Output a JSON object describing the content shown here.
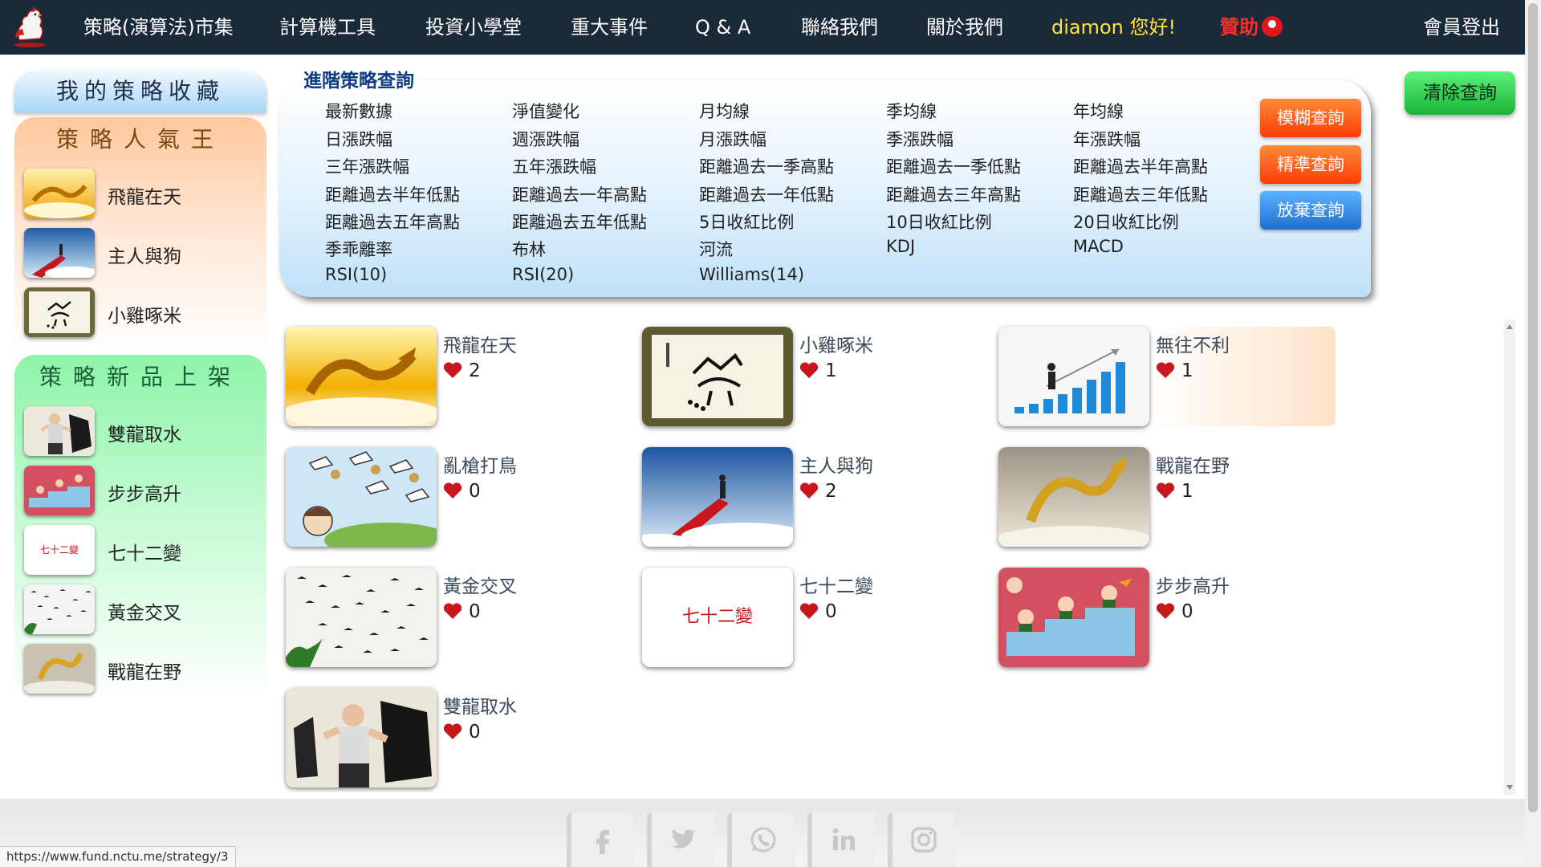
{
  "navbar": {
    "items": [
      "策略(演算法)市集",
      "計算機工具",
      "投資小學堂",
      "重大事件",
      "Q & A",
      "聯絡我們",
      "關於我們"
    ],
    "greeting": "diamon 您好!",
    "sponsor": "贊助",
    "logout": "會員登出"
  },
  "sidebar": {
    "favorites_title": "我的策略收藏",
    "popular_title": "策略人氣王",
    "popular": [
      {
        "name": "飛龍在天",
        "icon": "golden-dragon"
      },
      {
        "name": "主人與狗",
        "icon": "man-on-red-stairs"
      },
      {
        "name": "小雞啄米",
        "icon": "chick-calligraphy"
      }
    ],
    "new_title": "策略新品上架",
    "new": [
      {
        "name": "雙龍取水",
        "icon": "kungfu-master"
      },
      {
        "name": "步步高升",
        "icon": "kids-on-steps"
      },
      {
        "name": "七十二變",
        "icon": "text-tile",
        "thumb_text": "七十二變"
      },
      {
        "name": "黃金交叉",
        "icon": "birds-flock"
      },
      {
        "name": "戰龍在野",
        "icon": "golden-dragon-clouds"
      }
    ]
  },
  "query": {
    "title": "進階策略查詢",
    "items": [
      "最新數據",
      "淨值變化",
      "月均線",
      "季均線",
      "年均線",
      "日漲跌幅",
      "週漲跌幅",
      "月漲跌幅",
      "季漲跌幅",
      "年漲跌幅",
      "三年漲跌幅",
      "五年漲跌幅",
      "距離過去一季高點",
      "距離過去一季低點",
      "距離過去半年高點",
      "距離過去半年低點",
      "距離過去一年高點",
      "距離過去一年低點",
      "距離過去三年高點",
      "距離過去三年低點",
      "距離過去五年高點",
      "距離過去五年低點",
      "5日收紅比例",
      "10日收紅比例",
      "20日收紅比例",
      "季乖離率",
      "布林",
      "河流",
      "KDJ",
      "MACD",
      "RSI(10)",
      "RSI(20)",
      "Williams(14)"
    ],
    "buttons": {
      "fuzzy": "模糊查詢",
      "exact": "精準查詢",
      "cancel": "放棄查詢"
    },
    "clear": "清除查詢"
  },
  "strategies": [
    {
      "name": "飛龍在天",
      "likes": "2",
      "icon": "golden-dragon"
    },
    {
      "name": "小雞啄米",
      "likes": "1",
      "icon": "chick-calligraphy"
    },
    {
      "name": "無往不利",
      "likes": "1",
      "icon": "businessman-bar-chart"
    },
    {
      "name": "亂槍打鳥",
      "likes": "0",
      "icon": "cartoon-storks"
    },
    {
      "name": "主人與狗",
      "likes": "2",
      "icon": "man-on-red-stairs"
    },
    {
      "name": "戰龍在野",
      "likes": "1",
      "icon": "golden-dragon-clouds"
    },
    {
      "name": "黃金交叉",
      "likes": "0",
      "icon": "birds-flock"
    },
    {
      "name": "七十二變",
      "likes": "0",
      "icon": "text-tile",
      "thumb_text": "七十二變"
    },
    {
      "name": "步步高升",
      "likes": "0",
      "icon": "kids-on-steps"
    },
    {
      "name": "雙龍取水",
      "likes": "0",
      "icon": "kungfu-master"
    }
  ],
  "footer": {
    "social": [
      "facebook-icon",
      "twitter-icon",
      "whatsapp-icon",
      "linkedin-icon",
      "instagram-icon"
    ]
  },
  "status_url": "https://www.fund.nctu.me/strategy/3",
  "colors": {
    "navbar": "#1b2a38",
    "greeting": "#ffe23a",
    "sponsor": "#ff2a2a",
    "query_title": "#0f3b82",
    "fuzzy_button": "#ff4a0a",
    "cancel_button": "#2a7fd8",
    "clear_button": "#22c244",
    "heart": "#c8161d"
  }
}
